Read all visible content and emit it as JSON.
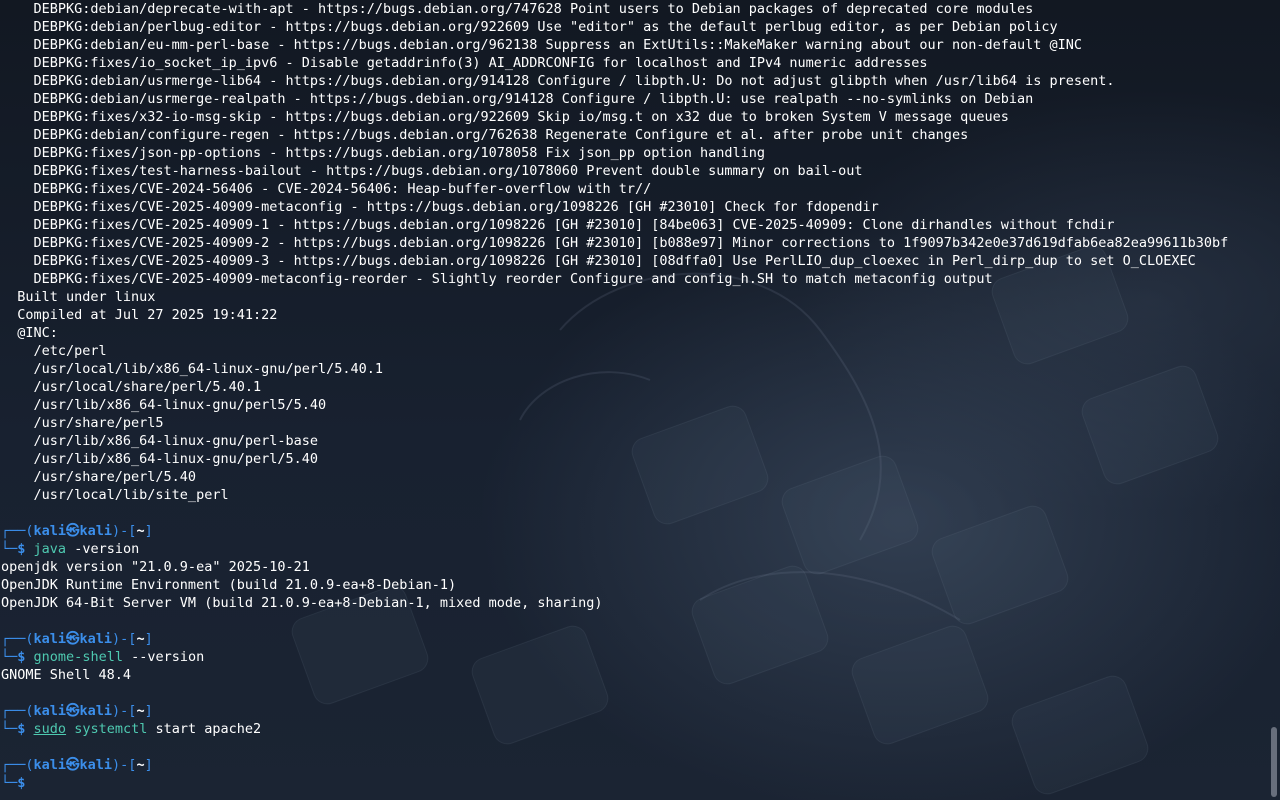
{
  "terminal": {
    "output_lines": [
      "    DEBPKG:debian/deprecate-with-apt - https://bugs.debian.org/747628 Point users to Debian packages of deprecated core modules",
      "    DEBPKG:debian/perlbug-editor - https://bugs.debian.org/922609 Use \"editor\" as the default perlbug editor, as per Debian policy",
      "    DEBPKG:debian/eu-mm-perl-base - https://bugs.debian.org/962138 Suppress an ExtUtils::MakeMaker warning about our non-default @INC",
      "    DEBPKG:fixes/io_socket_ip_ipv6 - Disable getaddrinfo(3) AI_ADDRCONFIG for localhost and IPv4 numeric addresses",
      "    DEBPKG:debian/usrmerge-lib64 - https://bugs.debian.org/914128 Configure / libpth.U: Do not adjust glibpth when /usr/lib64 is present.",
      "    DEBPKG:debian/usrmerge-realpath - https://bugs.debian.org/914128 Configure / libpth.U: use realpath --no-symlinks on Debian",
      "    DEBPKG:fixes/x32-io-msg-skip - https://bugs.debian.org/922609 Skip io/msg.t on x32 due to broken System V message queues",
      "    DEBPKG:debian/configure-regen - https://bugs.debian.org/762638 Regenerate Configure et al. after probe unit changes",
      "    DEBPKG:fixes/json-pp-options - https://bugs.debian.org/1078058 Fix json_pp option handling",
      "    DEBPKG:fixes/test-harness-bailout - https://bugs.debian.org/1078060 Prevent double summary on bail-out",
      "    DEBPKG:fixes/CVE-2024-56406 - CVE-2024-56406: Heap-buffer-overflow with tr//",
      "    DEBPKG:fixes/CVE-2025-40909-metaconfig - https://bugs.debian.org/1098226 [GH #23010] Check for fdopendir",
      "    DEBPKG:fixes/CVE-2025-40909-1 - https://bugs.debian.org/1098226 [GH #23010] [84be063] CVE-2025-40909: Clone dirhandles without fchdir",
      "    DEBPKG:fixes/CVE-2025-40909-2 - https://bugs.debian.org/1098226 [GH #23010] [b088e97] Minor corrections to 1f9097b342e0e37d619dfab6ea82ea99611b30bf",
      "    DEBPKG:fixes/CVE-2025-40909-3 - https://bugs.debian.org/1098226 [GH #23010] [08dffa0] Use PerlLIO_dup_cloexec in Perl_dirp_dup to set O_CLOEXEC",
      "    DEBPKG:fixes/CVE-2025-40909-metaconfig-reorder - Slightly reorder Configure and config_h.SH to match metaconfig output",
      "  Built under linux",
      "  Compiled at Jul 27 2025 19:41:22",
      "  @INC:",
      "    /etc/perl",
      "    /usr/local/lib/x86_64-linux-gnu/perl/5.40.1",
      "    /usr/local/share/perl/5.40.1",
      "    /usr/lib/x86_64-linux-gnu/perl5/5.40",
      "    /usr/share/perl5",
      "    /usr/lib/x86_64-linux-gnu/perl-base",
      "    /usr/lib/x86_64-linux-gnu/perl/5.40",
      "    /usr/share/perl/5.40",
      "    /usr/local/lib/site_perl"
    ],
    "prompt": {
      "top_left": "┌──(",
      "user": "kali",
      "skull": "㉿",
      "host": "kali",
      "mid": ")-[",
      "path": "~",
      "end": "]",
      "bottom_left": "└─",
      "dollar": "$"
    },
    "commands": [
      {
        "cmd": "java",
        "args": " -version",
        "sudo": "",
        "output": [
          "openjdk version \"21.0.9-ea\" 2025-10-21",
          "OpenJDK Runtime Environment (build 21.0.9-ea+8-Debian-1)",
          "OpenJDK 64-Bit Server VM (build 21.0.9-ea+8-Debian-1, mixed mode, sharing)"
        ]
      },
      {
        "cmd": "gnome-shell",
        "args": " --version",
        "sudo": "",
        "output": [
          "GNOME Shell 48.4"
        ]
      },
      {
        "cmd": "systemctl",
        "args": " start apache2",
        "sudo": "sudo",
        "output": []
      }
    ]
  },
  "colors": {
    "background": "#141a24",
    "prompt_blue": "#3b8eea",
    "command_green": "#4ec9b0",
    "text": "#ffffff"
  }
}
